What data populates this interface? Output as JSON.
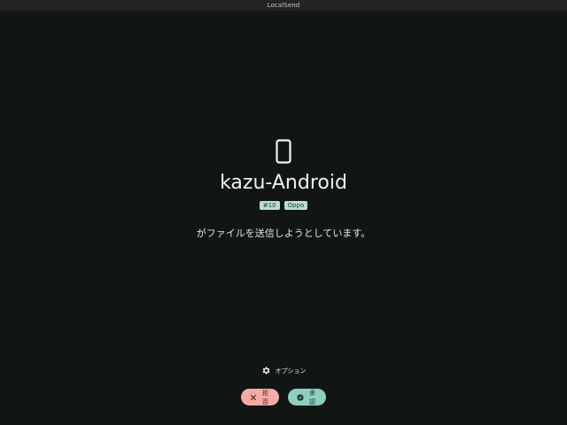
{
  "window": {
    "title": "LocalSend"
  },
  "sender": {
    "device_icon": "smartphone-icon",
    "name": "kazu-Android",
    "badges": [
      "#10",
      "Oppo"
    ]
  },
  "message": "がファイルを送信しようとしています。",
  "options": {
    "icon": "gear-icon",
    "label": "オプション"
  },
  "actions": {
    "decline": {
      "icon": "close-icon",
      "label": "拒否"
    },
    "accept": {
      "icon": "check-circle-icon",
      "label": "承認"
    }
  },
  "colors": {
    "background": "#111615",
    "badge": "#b9ddd4",
    "decline": "#f4aaa6",
    "accept": "#8ecfc0"
  }
}
